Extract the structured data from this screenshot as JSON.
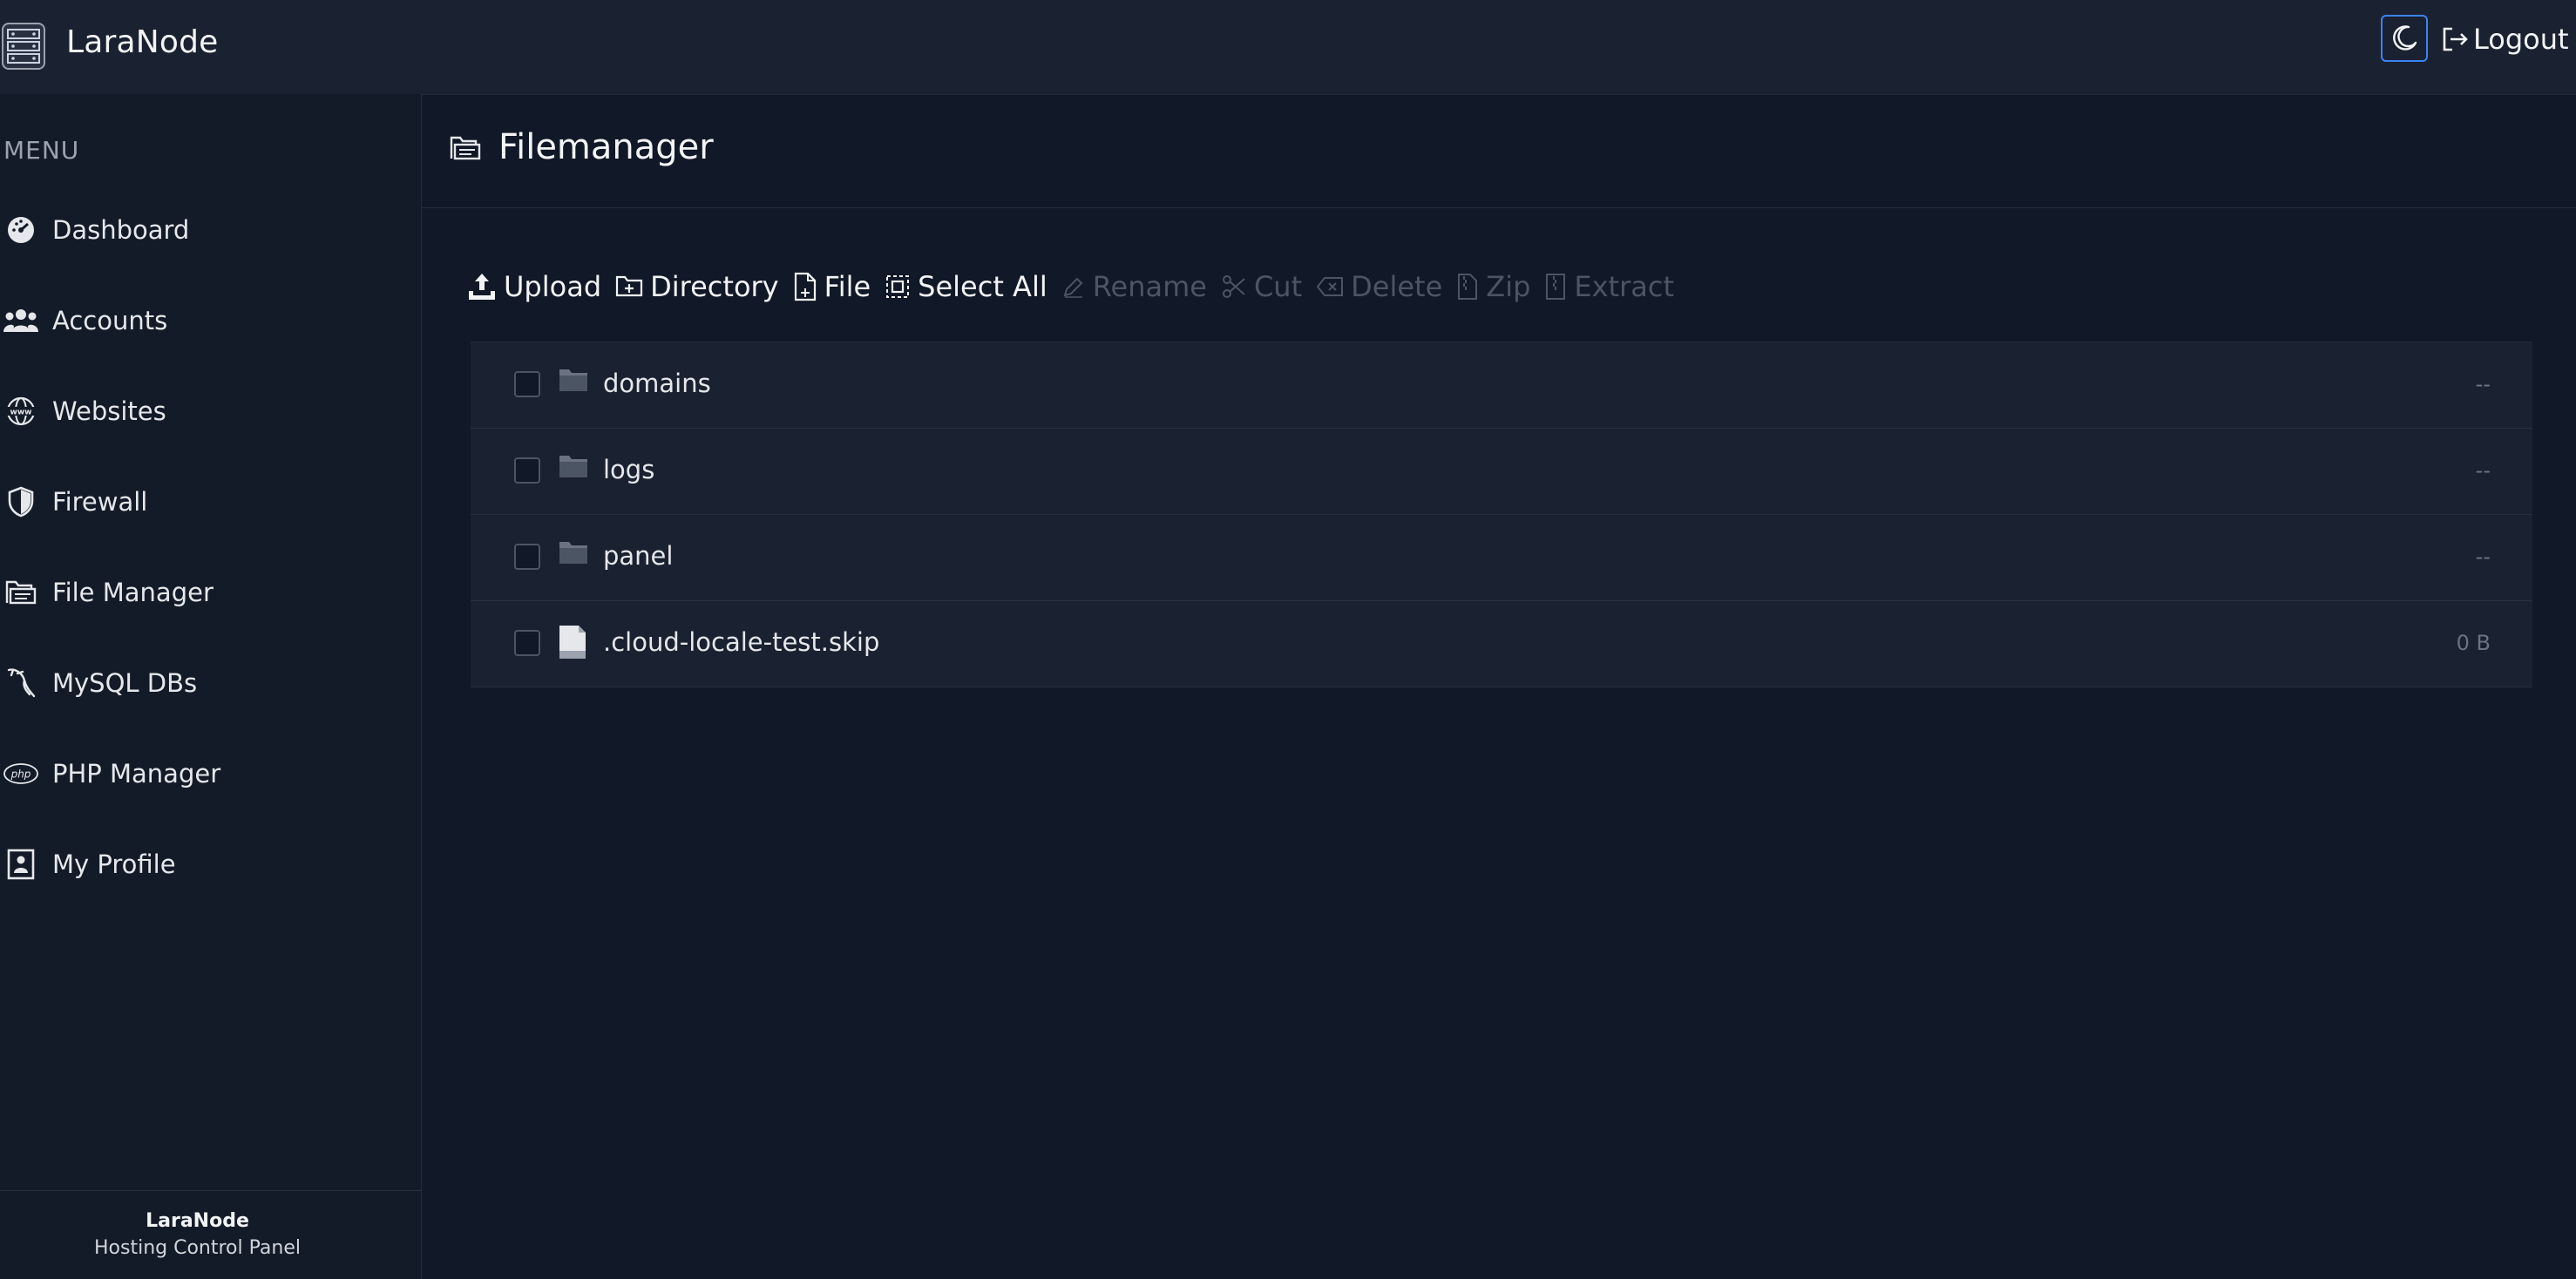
{
  "app": {
    "name": "LaraNode"
  },
  "header": {
    "logout_label": "Logout"
  },
  "sidebar": {
    "menu_title": "MENU",
    "items": [
      {
        "label": "Dashboard",
        "icon": "gauge-icon"
      },
      {
        "label": "Accounts",
        "icon": "users-icon"
      },
      {
        "label": "Websites",
        "icon": "www-globe-icon"
      },
      {
        "label": "Firewall",
        "icon": "shield-icon"
      },
      {
        "label": "File Manager",
        "icon": "folder-open-icon"
      },
      {
        "label": "MySQL DBs",
        "icon": "dolphin-icon"
      },
      {
        "label": "PHP Manager",
        "icon": "php-icon"
      },
      {
        "label": "My Profile",
        "icon": "profile-card-icon"
      }
    ],
    "footer": {
      "title": "LaraNode",
      "subtitle": "Hosting Control Panel"
    }
  },
  "page": {
    "title": "Filemanager"
  },
  "toolbar": {
    "upload": "Upload",
    "directory": "Directory",
    "file": "File",
    "select_all": "Select All",
    "rename": "Rename",
    "cut": "Cut",
    "delete": "Delete",
    "zip": "Zip",
    "extract": "Extract"
  },
  "files": [
    {
      "name": "domains",
      "type": "folder",
      "size": "--"
    },
    {
      "name": "logs",
      "type": "folder",
      "size": "--"
    },
    {
      "name": "panel",
      "type": "folder",
      "size": "--"
    },
    {
      "name": ".cloud-locale-test.skip",
      "type": "file",
      "size": "0 B"
    }
  ],
  "colors": {
    "accent": "#3b82f6",
    "background": "#111827",
    "panel": "#1a2130"
  }
}
